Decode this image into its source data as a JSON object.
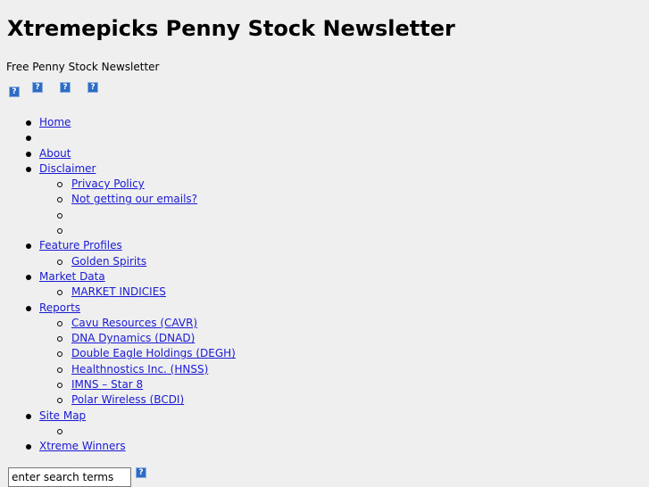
{
  "header": {
    "site_title": "Xtremepicks Penny Stock Newsletter",
    "tagline": "Free Penny Stock Newsletter"
  },
  "icon_row": {
    "icons": [
      "broken-image-icon",
      "broken-image-icon",
      "broken-image-icon",
      "broken-image-icon"
    ],
    "glyph": "?"
  },
  "menu": {
    "home": "Home",
    "about": "About",
    "disclaimer": "Disclaimer",
    "privacy_policy": "Privacy Policy",
    "not_getting_emails": "Not getting our emails?",
    "feature_profiles": "Feature Profiles",
    "golden_spirits": "Golden Spirits",
    "market_data": "Market Data",
    "market_indicies": "MARKET INDICIES",
    "reports": "Reports",
    "cavu": "Cavu Resources (CAVR)",
    "dna": "DNA Dynamics (DNAD)",
    "double_eagle": "Double Eagle Holdings (DEGH)",
    "healthnostics": "Healthnostics Inc. (HNSS)",
    "imns": "IMNS – Star 8",
    "polar": "Polar Wireless (BCDI)",
    "site_map": "Site Map",
    "xtreme_winners": "Xtreme Winners"
  },
  "search": {
    "value": "enter search terms",
    "button_glyph": "?"
  },
  "colors": {
    "background": "#efefef",
    "link": "#1a1ad4",
    "icon_fill": "#2c6cc4"
  }
}
